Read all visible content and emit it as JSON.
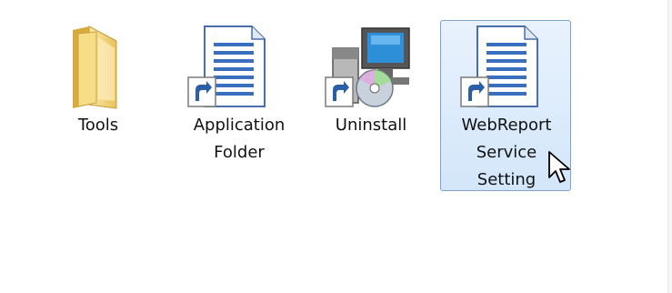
{
  "window": {
    "background": "#ffffff"
  },
  "items": [
    {
      "label": "Tools",
      "icon": "folder-icon",
      "selected": false
    },
    {
      "label": "Application Folder",
      "icon": "document-shortcut-icon",
      "selected": false
    },
    {
      "label": "Uninstall",
      "icon": "installer-shortcut-icon",
      "selected": false
    },
    {
      "label": "WebReport Service Setting",
      "icon": "document-shortcut-icon",
      "selected": true
    }
  ],
  "colors": {
    "selection_border": "#7da2ce",
    "selection_fill": "#dbe9fa",
    "folder_yellow": "#f5d46e",
    "document_blue": "#3a6fbf"
  }
}
